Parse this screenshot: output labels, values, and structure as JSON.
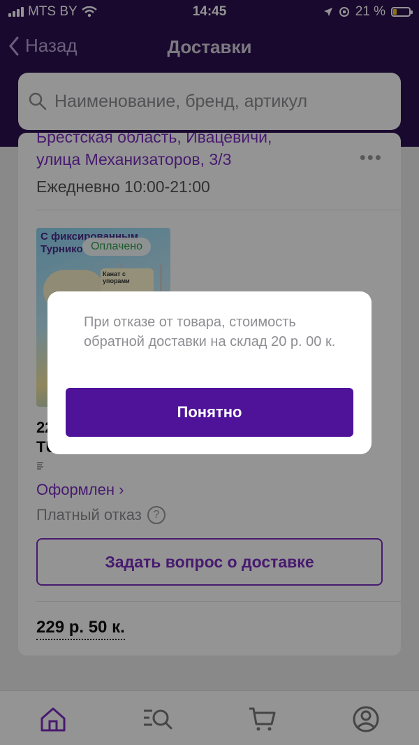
{
  "status_bar": {
    "carrier": "MTS BY",
    "time": "14:45",
    "battery": "21 %",
    "battery_level": 0.21
  },
  "nav": {
    "back_label": "Назад",
    "title": "Доставки"
  },
  "search": {
    "placeholder": "Наименование, бренд, артикул"
  },
  "delivery": {
    "address_line1": "Брестская область, Ивацевичи,",
    "address_line2": "улица Механизаторов, 3/3",
    "hours": "Ежедневно 10:00-21:00",
    "product_image_title": "С фиксированным Турнико",
    "paid_badge": "Оплачено",
    "image_tag_text": "Канат с упорами",
    "product_name_line1": "22",
    "product_name_line2": "TU",
    "order_status": "Оформлен ›",
    "refusal_label": "Платный отказ",
    "refusal_help": "?",
    "ask_button": "Задать вопрос о доставке",
    "price": "229 р. 50 к."
  },
  "dialog": {
    "message": "При отказе от товара, стоимость обратной доставки на склад 20 р. 00 к.",
    "ok_button": "Понятно"
  },
  "tabbar": {
    "items": [
      "home-icon",
      "catalog-search-icon",
      "cart-icon",
      "profile-icon"
    ]
  },
  "colors": {
    "header_bg": "#2c1150",
    "accent": "#7b2dbf",
    "button_primary": "#4f139a",
    "paid_green": "#2e9e4a"
  }
}
